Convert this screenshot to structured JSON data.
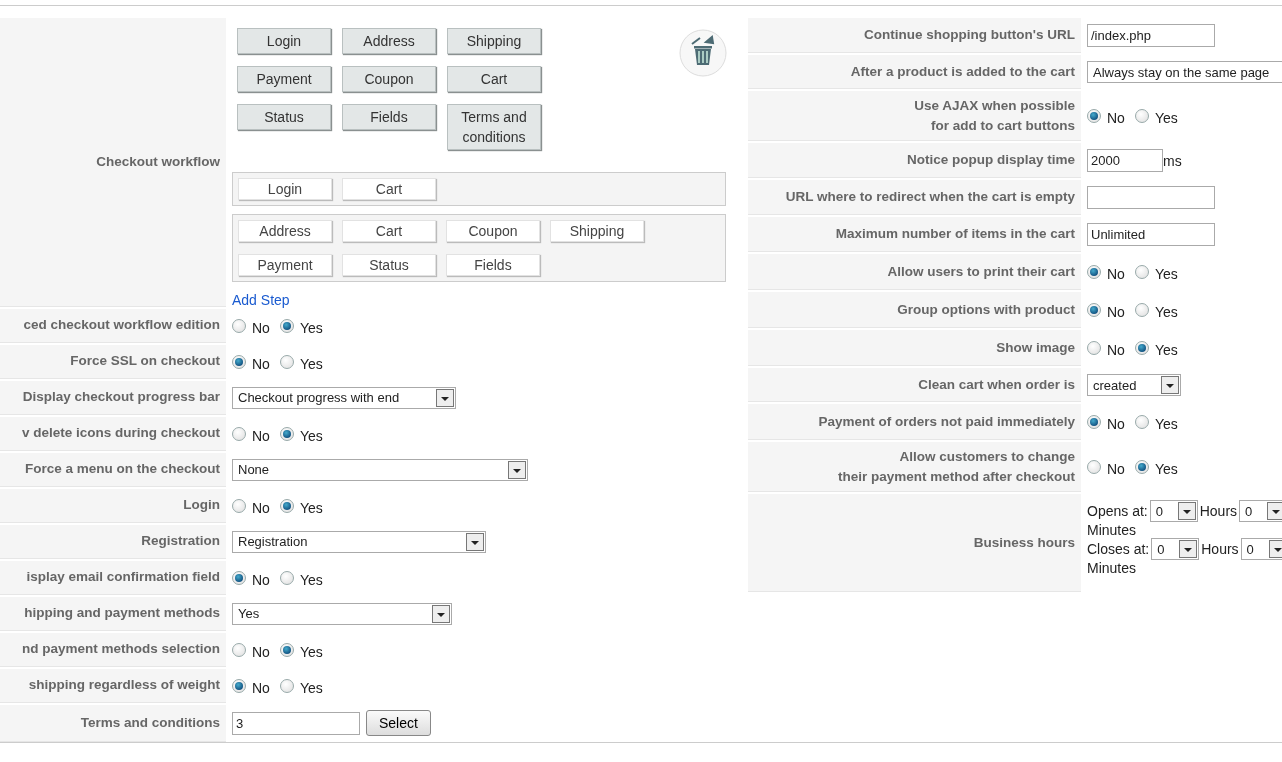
{
  "left": {
    "workflow": {
      "label": "Checkout workflow",
      "available_steps": [
        "Login",
        "Address",
        "Shipping",
        "Payment",
        "Coupon",
        "Cart",
        "Status",
        "Fields",
        "Terms and conditions"
      ],
      "steps": [
        [
          "Login",
          "Cart"
        ],
        [
          "Address",
          "Cart",
          "Coupon",
          "Shipping",
          "Payment",
          "Status",
          "Fields"
        ]
      ],
      "add_step": "Add Step"
    },
    "rows": [
      {
        "label": "ced checkout workflow edition",
        "kind": "radio",
        "options": [
          {
            "label": "No",
            "selected": false
          },
          {
            "label": "Yes",
            "selected": true
          }
        ]
      },
      {
        "label": "Force SSL on checkout",
        "kind": "radio",
        "options": [
          {
            "label": "No",
            "selected": true
          },
          {
            "label": "Yes",
            "selected": false
          }
        ]
      },
      {
        "label": "Display checkout progress bar",
        "kind": "select",
        "value": "Checkout progress with end"
      },
      {
        "label": "v delete icons during checkout",
        "kind": "radio",
        "options": [
          {
            "label": "No",
            "selected": false
          },
          {
            "label": "Yes",
            "selected": true
          }
        ]
      },
      {
        "label": "Force a menu on the checkout",
        "kind": "select",
        "value": "None"
      },
      {
        "label": "Login",
        "kind": "radio",
        "options": [
          {
            "label": "No",
            "selected": false
          },
          {
            "label": "Yes",
            "selected": true
          }
        ]
      },
      {
        "label": "Registration",
        "kind": "select",
        "value": "Registration"
      },
      {
        "label": "isplay email confirmation field",
        "kind": "radio",
        "options": [
          {
            "label": "No",
            "selected": true
          },
          {
            "label": "Yes",
            "selected": false
          }
        ]
      },
      {
        "label": "hipping and payment methods",
        "kind": "select",
        "value": "Yes"
      },
      {
        "label": "nd payment methods selection",
        "kind": "radio",
        "options": [
          {
            "label": "No",
            "selected": false
          },
          {
            "label": "Yes",
            "selected": true
          }
        ]
      },
      {
        "label": "shipping regardless of weight",
        "kind": "radio",
        "options": [
          {
            "label": "No",
            "selected": true
          },
          {
            "label": "Yes",
            "selected": false
          }
        ]
      },
      {
        "label": "Terms and conditions",
        "kind": "picker",
        "value": "3",
        "button": "Select"
      }
    ]
  },
  "right": {
    "rows": [
      {
        "label": "Continue shopping button's URL",
        "kind": "text",
        "value": "/index.php"
      },
      {
        "label": "After a product is added to the cart",
        "kind": "select",
        "value": "Always stay on the same page"
      },
      {
        "label": "Use AJAX when possible\nfor add to cart buttons",
        "kind": "radio",
        "options": [
          {
            "label": "No",
            "selected": true
          },
          {
            "label": "Yes",
            "selected": false
          }
        ]
      },
      {
        "label": "Notice popup display time",
        "kind": "text_unit",
        "value": "2000",
        "unit": "ms"
      },
      {
        "label": "URL where to redirect when the cart is empty",
        "kind": "text",
        "value": ""
      },
      {
        "label": "Maximum number of items in the cart",
        "kind": "text",
        "value": "Unlimited"
      },
      {
        "label": "Allow users to print their cart",
        "kind": "radio",
        "options": [
          {
            "label": "No",
            "selected": true
          },
          {
            "label": "Yes",
            "selected": false
          }
        ]
      },
      {
        "label": "Group options with product",
        "kind": "radio",
        "options": [
          {
            "label": "No",
            "selected": true
          },
          {
            "label": "Yes",
            "selected": false
          }
        ]
      },
      {
        "label": "Show image",
        "kind": "radio",
        "options": [
          {
            "label": "No",
            "selected": false
          },
          {
            "label": "Yes",
            "selected": true
          }
        ]
      },
      {
        "label": "Clean cart when order is",
        "kind": "select",
        "value": "created"
      },
      {
        "label": "Payment of orders not paid immediately",
        "kind": "radio",
        "options": [
          {
            "label": "No",
            "selected": true
          },
          {
            "label": "Yes",
            "selected": false
          }
        ]
      },
      {
        "label": "Allow customers to change\ntheir payment method after checkout",
        "kind": "radio",
        "options": [
          {
            "label": "No",
            "selected": false
          },
          {
            "label": "Yes",
            "selected": true
          }
        ]
      },
      {
        "label": "Business hours",
        "kind": "hours",
        "lines": [
          {
            "label": "Opens at:",
            "hour": "0",
            "hours_label": "Hours",
            "minute": "0",
            "minutes_label": "Minutes"
          },
          {
            "label": "Closes at:",
            "hour": "0",
            "hours_label": "Hours",
            "minute": "0",
            "minutes_label": "Minutes"
          }
        ]
      }
    ]
  }
}
